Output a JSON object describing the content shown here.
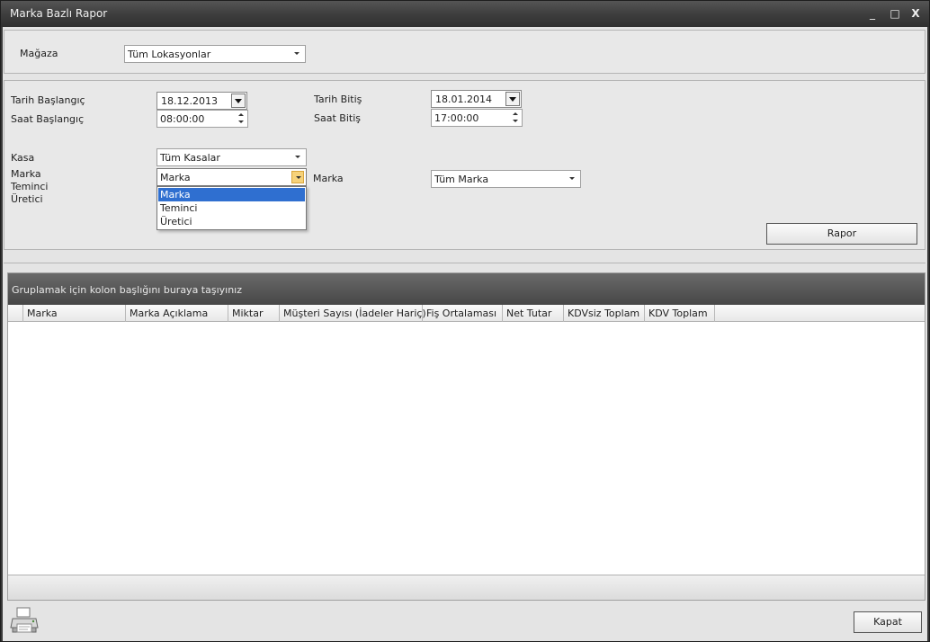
{
  "window": {
    "title": "Marka Bazlı Rapor",
    "minimize": "_",
    "maximize": "□",
    "close": "X"
  },
  "store": {
    "label": "Mağaza",
    "value": "Tüm Lokasyonlar"
  },
  "dates": {
    "start_date_label": "Tarih Başlangıç",
    "start_date_value": "18.12.2013",
    "end_date_label": "Tarih Bitiş",
    "end_date_value": "18.01.2014",
    "start_time_label": "Saat Başlangıç",
    "start_time_value": "08:00:00",
    "end_time_label": "Saat Bitiş",
    "end_time_value": "17:00:00"
  },
  "filters": {
    "kasa_label": "Kasa",
    "kasa_value": "Tüm Kasalar",
    "group_labels": [
      "Marka",
      "Teminci",
      "Üretici"
    ],
    "group_value": "Marka",
    "group_options": [
      "Marka",
      "Teminci",
      "Üretici"
    ],
    "marka_label": "Marka",
    "marka_value": "Tüm Marka"
  },
  "actions": {
    "report_label": "Rapor",
    "close_label": "Kapat"
  },
  "grid": {
    "group_hint": "Gruplamak için kolon başlığını buraya taşıyınız",
    "columns": [
      "Marka",
      "Marka Açıklama",
      "Miktar",
      "Müşteri Sayısı (İadeler Hariç)",
      "Fiş Ortalaması",
      "Net Tutar",
      "KDVsiz Toplam",
      "KDV Toplam"
    ]
  },
  "icons": {
    "print": "printer-icon"
  }
}
